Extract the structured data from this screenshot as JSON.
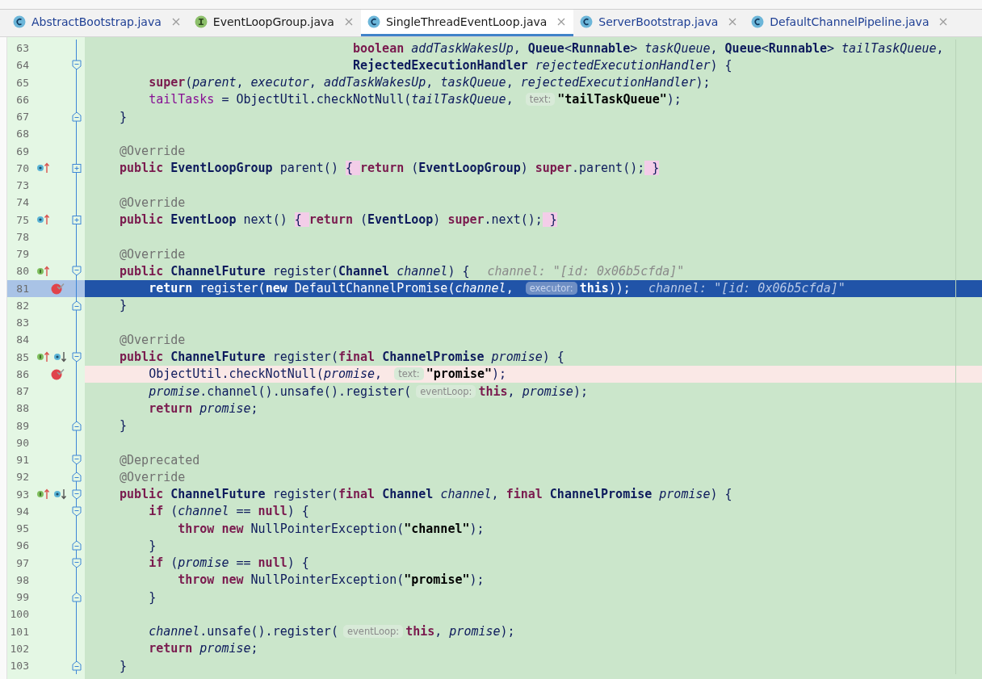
{
  "tabs": [
    {
      "label": "AbstractBootstrap.java",
      "kind": "class",
      "modified": true,
      "selected": false
    },
    {
      "label": "EventLoopGroup.java",
      "kind": "interface",
      "modified": false,
      "selected": false
    },
    {
      "label": "SingleThreadEventLoop.java",
      "kind": "class",
      "modified": false,
      "selected": true
    },
    {
      "label": "ServerBootstrap.java",
      "kind": "class",
      "modified": true,
      "selected": false
    },
    {
      "label": "DefaultChannelPipeline.java",
      "kind": "class",
      "modified": true,
      "selected": false
    }
  ],
  "lines": [
    {
      "n": "63",
      "tokens": [
        {
          "text": "                                boolean ",
          "kind": "kw"
        },
        {
          "text": "addTaskWakesUp",
          "kind": "param"
        },
        {
          "text": ", ",
          "kind": "plain"
        },
        {
          "text": "Queue",
          "kind": "type"
        },
        {
          "text": "<",
          "kind": "plain"
        },
        {
          "text": "Runnable",
          "kind": "type"
        },
        {
          "text": "> ",
          "kind": "plain"
        },
        {
          "text": "taskQueue",
          "kind": "param"
        },
        {
          "text": ", ",
          "kind": "plain"
        },
        {
          "text": "Queue",
          "kind": "type"
        },
        {
          "text": "<",
          "kind": "plain"
        },
        {
          "text": "Runnable",
          "kind": "type"
        },
        {
          "text": "> ",
          "kind": "plain"
        },
        {
          "text": "tailTaskQueue",
          "kind": "param"
        },
        {
          "text": ",",
          "kind": "plain"
        }
      ]
    },
    {
      "n": "64",
      "fold": {
        "kind": "start"
      },
      "tokens": [
        {
          "text": "                                RejectedExecutionHandler ",
          "kind": "type"
        },
        {
          "text": "rejectedExecutionHandler",
          "kind": "param"
        },
        {
          "text": ") {",
          "kind": "plain"
        }
      ]
    },
    {
      "n": "65",
      "tokens": [
        {
          "text": "    super",
          "kind": "kw"
        },
        {
          "text": "(",
          "kind": "plain"
        },
        {
          "text": "parent",
          "kind": "param"
        },
        {
          "text": ", ",
          "kind": "plain"
        },
        {
          "text": "executor",
          "kind": "param"
        },
        {
          "text": ", ",
          "kind": "plain"
        },
        {
          "text": "addTaskWakesUp",
          "kind": "param"
        },
        {
          "text": ", ",
          "kind": "plain"
        },
        {
          "text": "taskQueue",
          "kind": "param"
        },
        {
          "text": ", ",
          "kind": "plain"
        },
        {
          "text": "rejectedExecutionHandler",
          "kind": "param"
        },
        {
          "text": ");",
          "kind": "plain"
        }
      ]
    },
    {
      "n": "66",
      "tokens": [
        {
          "text": "    tailTasks",
          "kind": "field"
        },
        {
          "text": " = ObjectUtil.checkNotNull(",
          "kind": "plain"
        },
        {
          "text": "tailTaskQueue",
          "kind": "param"
        },
        {
          "text": ", ",
          "kind": "plain"
        },
        {
          "text": "text:",
          "kind": "hint"
        },
        {
          "text": "\"tailTaskQueue\"",
          "kind": "str"
        },
        {
          "text": ");",
          "kind": "plain"
        }
      ]
    },
    {
      "n": "67",
      "fold": {
        "kind": "end"
      },
      "tokens": [
        {
          "text": "}",
          "kind": "plain"
        }
      ]
    },
    {
      "n": "68"
    },
    {
      "n": "69",
      "tokens": [
        {
          "text": "@Override",
          "kind": "ann"
        }
      ]
    },
    {
      "n": "70",
      "fold": {
        "kind": "collapsed"
      },
      "marks": [
        {
          "kind": "overrides"
        }
      ],
      "tokens": [
        {
          "text": "public ",
          "kind": "kw"
        },
        {
          "text": "EventLoopGroup",
          "kind": "type"
        },
        {
          "text": " parent() ",
          "kind": "plain"
        },
        {
          "text": "{ ",
          "kind": "foldbrace"
        },
        {
          "text": "return ",
          "kind": "kw"
        },
        {
          "text": "(",
          "kind": "plain"
        },
        {
          "text": "EventLoopGroup",
          "kind": "type"
        },
        {
          "text": ") ",
          "kind": "plain"
        },
        {
          "text": "super",
          "kind": "kw"
        },
        {
          "text": ".parent();",
          "kind": "plain"
        },
        {
          "text": " }",
          "kind": "foldbrace"
        }
      ]
    },
    {
      "n": "73"
    },
    {
      "n": "74",
      "tokens": [
        {
          "text": "@Override",
          "kind": "ann"
        }
      ]
    },
    {
      "n": "75",
      "fold": {
        "kind": "collapsed"
      },
      "marks": [
        {
          "kind": "overrides"
        }
      ],
      "tokens": [
        {
          "text": "public ",
          "kind": "kw"
        },
        {
          "text": "EventLoop",
          "kind": "type"
        },
        {
          "text": " next() ",
          "kind": "plain"
        },
        {
          "text": "{ ",
          "kind": "foldbrace"
        },
        {
          "text": "return ",
          "kind": "kw"
        },
        {
          "text": "(",
          "kind": "plain"
        },
        {
          "text": "EventLoop",
          "kind": "type"
        },
        {
          "text": ") ",
          "kind": "plain"
        },
        {
          "text": "super",
          "kind": "kw"
        },
        {
          "text": ".next();",
          "kind": "plain"
        },
        {
          "text": " }",
          "kind": "foldbrace"
        }
      ]
    },
    {
      "n": "78"
    },
    {
      "n": "79",
      "tokens": [
        {
          "text": "@Override",
          "kind": "ann"
        }
      ]
    },
    {
      "n": "80",
      "fold": {
        "kind": "start"
      },
      "marks": [
        {
          "kind": "implements"
        }
      ],
      "tokens": [
        {
          "text": "public ",
          "kind": "kw"
        },
        {
          "text": "ChannelFuture",
          "kind": "type"
        },
        {
          "text": " register(",
          "kind": "plain"
        },
        {
          "text": "Channel ",
          "kind": "type"
        },
        {
          "text": "channel",
          "kind": "param"
        },
        {
          "text": ") {",
          "kind": "plain"
        },
        {
          "text": "channel: \"[id: 0x06b5cfda]\"",
          "kind": "value"
        }
      ]
    },
    {
      "n": "81",
      "highlight": {
        "kind": "execution"
      },
      "marks": [
        {
          "kind": "breakpoint"
        }
      ],
      "tokens": [
        {
          "text": "    return",
          "kind": "kw"
        },
        {
          "text": " register(",
          "kind": "plain"
        },
        {
          "text": "new",
          "kind": "kw"
        },
        {
          "text": " DefaultChannelPromise(",
          "kind": "plain"
        },
        {
          "text": "channel",
          "kind": "param"
        },
        {
          "text": ", ",
          "kind": "plain"
        },
        {
          "text": "executor:",
          "kind": "hint"
        },
        {
          "text": "this",
          "kind": "kw"
        },
        {
          "text": "));",
          "kind": "plain"
        },
        {
          "text": "channel: \"[id: 0x06b5cfda]\"",
          "kind": "value"
        }
      ]
    },
    {
      "n": "82",
      "fold": {
        "kind": "end"
      },
      "tokens": [
        {
          "text": "}",
          "kind": "plain"
        }
      ]
    },
    {
      "n": "83"
    },
    {
      "n": "84",
      "tokens": [
        {
          "text": "@Override",
          "kind": "ann"
        }
      ]
    },
    {
      "n": "85",
      "fold": {
        "kind": "start"
      },
      "marks": [
        {
          "kind": "implements"
        },
        {
          "kind": "overridden"
        }
      ],
      "tokens": [
        {
          "text": "public ",
          "kind": "kw"
        },
        {
          "text": "ChannelFuture",
          "kind": "type"
        },
        {
          "text": " register(",
          "kind": "plain"
        },
        {
          "text": "final ",
          "kind": "kw"
        },
        {
          "text": "ChannelPromise ",
          "kind": "type"
        },
        {
          "text": "promise",
          "kind": "param"
        },
        {
          "text": ") {",
          "kind": "plain"
        }
      ]
    },
    {
      "n": "86",
      "highlight": {
        "kind": "breakpoint"
      },
      "marks": [
        {
          "kind": "breakpoint"
        }
      ],
      "tokens": [
        {
          "text": "    ObjectUtil.checkNotNull(",
          "kind": "plain"
        },
        {
          "text": "promise",
          "kind": "param"
        },
        {
          "text": ", ",
          "kind": "plain"
        },
        {
          "text": "text:",
          "kind": "hint"
        },
        {
          "text": "\"promise\"",
          "kind": "str"
        },
        {
          "text": ");",
          "kind": "plain"
        }
      ]
    },
    {
      "n": "87",
      "tokens": [
        {
          "text": "    promise",
          "kind": "param"
        },
        {
          "text": ".channel().unsafe().register(",
          "kind": "plain"
        },
        {
          "text": "eventLoop:",
          "kind": "hint"
        },
        {
          "text": "this",
          "kind": "kw"
        },
        {
          "text": ", ",
          "kind": "plain"
        },
        {
          "text": "promise",
          "kind": "param"
        },
        {
          "text": ");",
          "kind": "plain"
        }
      ]
    },
    {
      "n": "88",
      "tokens": [
        {
          "text": "    return ",
          "kind": "kw"
        },
        {
          "text": "promise",
          "kind": "param"
        },
        {
          "text": ";",
          "kind": "plain"
        }
      ]
    },
    {
      "n": "89",
      "fold": {
        "kind": "end"
      },
      "tokens": [
        {
          "text": "}",
          "kind": "plain"
        }
      ]
    },
    {
      "n": "90"
    },
    {
      "n": "91",
      "fold": {
        "kind": "start"
      },
      "tokens": [
        {
          "text": "@Deprecated",
          "kind": "ann"
        }
      ]
    },
    {
      "n": "92",
      "fold": {
        "kind": "end"
      },
      "tokens": [
        {
          "text": "@Override",
          "kind": "ann"
        }
      ]
    },
    {
      "n": "93",
      "fold": {
        "kind": "start"
      },
      "marks": [
        {
          "kind": "implements"
        },
        {
          "kind": "overridden"
        }
      ],
      "tokens": [
        {
          "text": "public ",
          "kind": "kw"
        },
        {
          "text": "ChannelFuture",
          "kind": "type"
        },
        {
          "text": " register(",
          "kind": "plain"
        },
        {
          "text": "final ",
          "kind": "kw"
        },
        {
          "text": "Channel ",
          "kind": "type"
        },
        {
          "text": "channel",
          "kind": "param"
        },
        {
          "text": ", ",
          "kind": "plain"
        },
        {
          "text": "final ",
          "kind": "kw"
        },
        {
          "text": "ChannelPromise ",
          "kind": "type"
        },
        {
          "text": "promise",
          "kind": "param"
        },
        {
          "text": ") {",
          "kind": "plain"
        }
      ]
    },
    {
      "n": "94",
      "fold": {
        "kind": "start"
      },
      "tokens": [
        {
          "text": "    if",
          "kind": "kw"
        },
        {
          "text": " (",
          "kind": "plain"
        },
        {
          "text": "channel",
          "kind": "param"
        },
        {
          "text": " == ",
          "kind": "plain"
        },
        {
          "text": "null",
          "kind": "kw"
        },
        {
          "text": ") {",
          "kind": "plain"
        }
      ]
    },
    {
      "n": "95",
      "tokens": [
        {
          "text": "        throw new",
          "kind": "kw"
        },
        {
          "text": " NullPointerException(",
          "kind": "plain"
        },
        {
          "text": "\"channel\"",
          "kind": "str"
        },
        {
          "text": ");",
          "kind": "plain"
        }
      ]
    },
    {
      "n": "96",
      "fold": {
        "kind": "end"
      },
      "tokens": [
        {
          "text": "    }",
          "kind": "plain"
        }
      ]
    },
    {
      "n": "97",
      "fold": {
        "kind": "start"
      },
      "tokens": [
        {
          "text": "    if",
          "kind": "kw"
        },
        {
          "text": " (",
          "kind": "plain"
        },
        {
          "text": "promise",
          "kind": "param"
        },
        {
          "text": " == ",
          "kind": "plain"
        },
        {
          "text": "null",
          "kind": "kw"
        },
        {
          "text": ") {",
          "kind": "plain"
        }
      ]
    },
    {
      "n": "98",
      "tokens": [
        {
          "text": "        throw new",
          "kind": "kw"
        },
        {
          "text": " NullPointerException(",
          "kind": "plain"
        },
        {
          "text": "\"promise\"",
          "kind": "str"
        },
        {
          "text": ");",
          "kind": "plain"
        }
      ]
    },
    {
      "n": "99",
      "fold": {
        "kind": "end"
      },
      "tokens": [
        {
          "text": "    }",
          "kind": "plain"
        }
      ]
    },
    {
      "n": "100"
    },
    {
      "n": "101",
      "tokens": [
        {
          "text": "    channel",
          "kind": "param"
        },
        {
          "text": ".unsafe().register(",
          "kind": "plain"
        },
        {
          "text": "eventLoop:",
          "kind": "hint"
        },
        {
          "text": "this",
          "kind": "kw"
        },
        {
          "text": ", ",
          "kind": "plain"
        },
        {
          "text": "promise",
          "kind": "param"
        },
        {
          "text": ");",
          "kind": "plain"
        }
      ]
    },
    {
      "n": "102",
      "tokens": [
        {
          "text": "    return ",
          "kind": "kw"
        },
        {
          "text": "promise",
          "kind": "param"
        },
        {
          "text": ";",
          "kind": "plain"
        }
      ]
    },
    {
      "n": "103",
      "fold": {
        "kind": "end"
      },
      "tokens": [
        {
          "text": "}",
          "kind": "plain"
        }
      ]
    }
  ]
}
